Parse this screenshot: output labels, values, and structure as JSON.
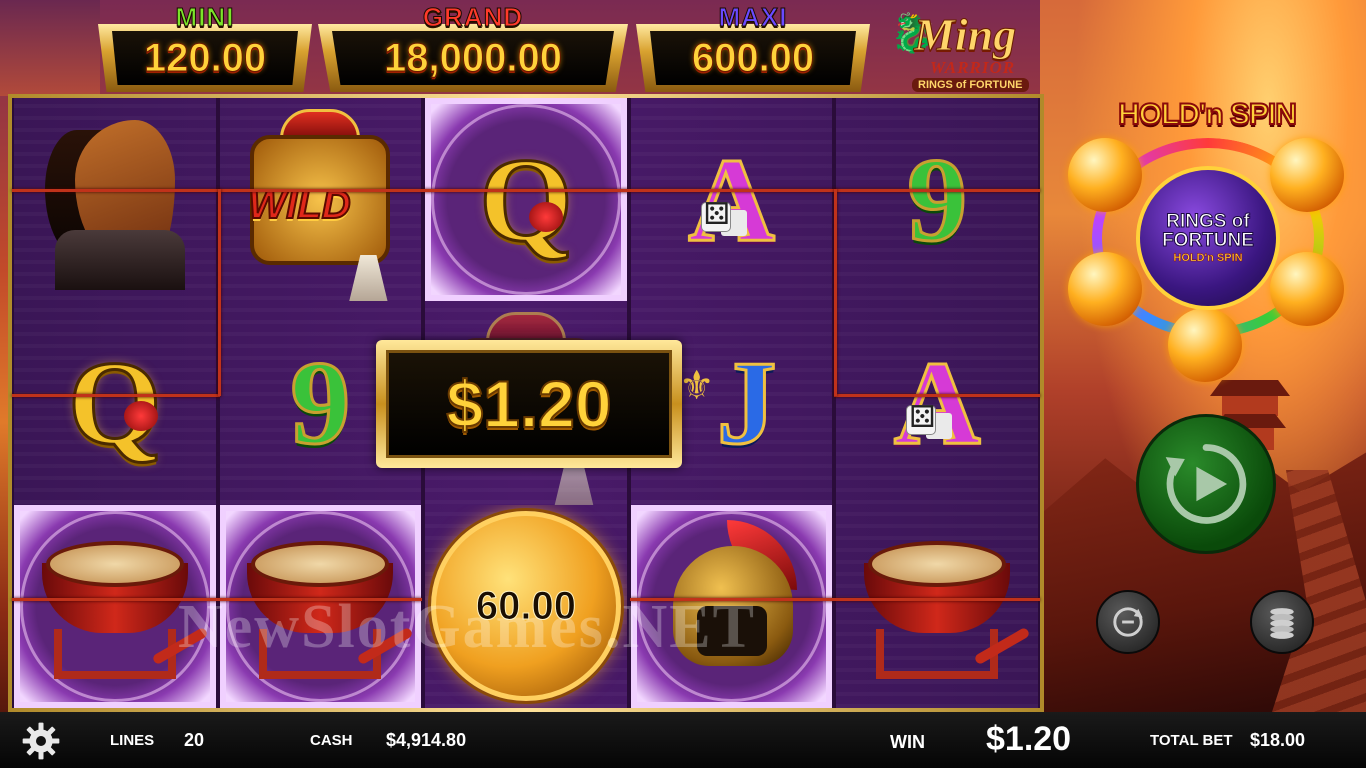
{
  "jackpots": {
    "mini": {
      "label": "MINI",
      "value": "120.00"
    },
    "grand": {
      "label": "GRAND",
      "value": "18,000.00"
    },
    "maxi": {
      "label": "MAXI",
      "value": "600.00"
    }
  },
  "logo": {
    "title": "Ming",
    "subtitle": "WARRIOR",
    "tagline": "RINGS of FORTUNE"
  },
  "reels": {
    "coin_value": "60.00"
  },
  "win_overlay": {
    "amount": "$1.20"
  },
  "hold_n_spin": {
    "title": "HOLD'n SPIN",
    "center_line1": "RINGS of",
    "center_line2": "FORTUNE",
    "center_line3": "HOLD'n SPIN"
  },
  "watermark": "NewSlotGames.NET",
  "bottom_bar": {
    "lines_label": "LINES",
    "lines_value": "20",
    "cash_label": "CASH",
    "cash_value": "$4,914.80",
    "win_label": "WIN",
    "win_value": "$1.20",
    "total_bet_label": "TOTAL BET",
    "total_bet_value": "$18.00"
  },
  "icons": {
    "settings": "gear-icon",
    "spin": "spin-icon",
    "autoplay": "autoplay-icon",
    "stake": "coin-stack-icon"
  },
  "colors": {
    "jackpot_value": "#ffd23a",
    "payline": "#c0321a",
    "spin_button": "#0a4a0a"
  }
}
